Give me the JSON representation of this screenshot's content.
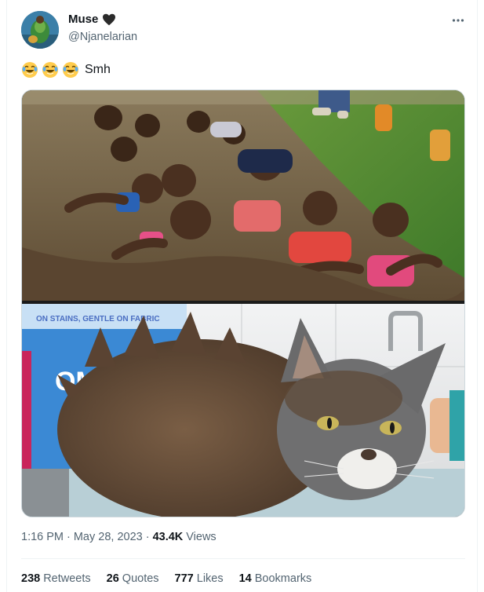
{
  "author": {
    "display_name": "Muse",
    "handle": "@Njanelarian"
  },
  "icons": {
    "avatar": "avatar-image",
    "name_badge": "black-heart-icon",
    "more": "more-options-icon",
    "text_emoji": "face-with-tears-of-joy-emoji"
  },
  "tweet": {
    "text": "Smh",
    "emoji_count": 3
  },
  "media": {
    "photos": [
      "people-in-mud-photo",
      "muddy-cat-photo"
    ],
    "packaging_text": "ON STAINS, GENTLE ON FABRIC",
    "packaging_brand_fragment": "OM"
  },
  "meta": {
    "time": "1:16 PM",
    "separator": "·",
    "date": "May 28, 2023",
    "views_count": "43.4K",
    "views_label": "Views"
  },
  "stats": [
    {
      "count": "238",
      "label": "Retweets"
    },
    {
      "count": "26",
      "label": "Quotes"
    },
    {
      "count": "777",
      "label": "Likes"
    },
    {
      "count": "14",
      "label": "Bookmarks"
    }
  ],
  "colors": {
    "primary_text": "#0f1419",
    "secondary_text": "#536471",
    "divider": "#eff3f4",
    "media_border": "#cfd9de"
  }
}
